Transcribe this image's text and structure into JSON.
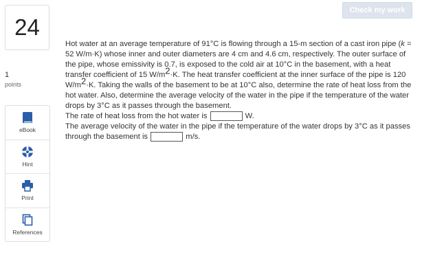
{
  "header": {
    "check_label": "Check my work"
  },
  "question": {
    "number": "24",
    "points_value": "1",
    "points_label": "points"
  },
  "tools": [
    {
      "label": "eBook",
      "icon": "book-icon"
    },
    {
      "label": "Hint",
      "icon": "hint-icon"
    },
    {
      "label": "Print",
      "icon": "print-icon"
    },
    {
      "label": "References",
      "icon": "references-icon"
    }
  ],
  "problem": {
    "p1": "Hot water at an average temperature of 91°C is flowing through a 15-m section of a cast iron pipe (",
    "k_var": "k",
    "p2": " = 52 W/m·K) whose inner and outer diameters are 4 cm and 4.6 cm, respectively. The outer surface of the pipe, whose emissivity is 0.7, is exposed to the cold air at 10°C in the basement, with a heat transfer coefficient of 15 W/m",
    "sup1": "2",
    "p3": "·K. The heat transfer coefficient at the inner surface of the pipe is 120 W/m",
    "sup2": "2",
    "p4": "·K. Taking the walls of the basement to be at 10°C also, determine the rate of heat loss from the hot water. Also, determine the average velocity of the water in the pipe if the temperature of the water drops by 3°C as it passes through the basement."
  },
  "answer1": {
    "prompt": "The rate of heat loss from the hot water is",
    "value": "",
    "unit": "W."
  },
  "answer2": {
    "prompt": "The average velocity of the water in the pipe if the temperature of the water drops by 3°C as it passes through the basement is",
    "value": "",
    "unit": "m/s."
  },
  "colors": {
    "accent": "#2a5ea8",
    "button_bg": "#dde4ee"
  }
}
